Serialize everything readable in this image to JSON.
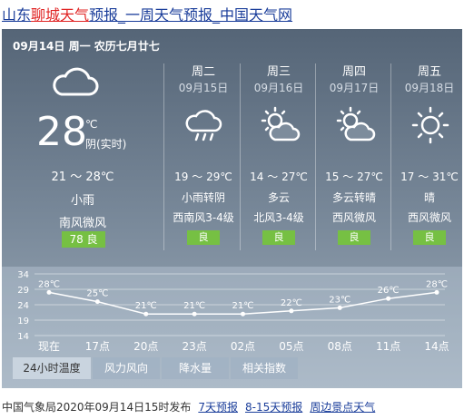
{
  "page_title": {
    "part1": "山东",
    "part2": "聊城天气",
    "part3": "预报_一周天气预报_中国天气网"
  },
  "date_line": "09月14日 周一 农历七月廿七",
  "today": {
    "icon": "cloudy-icon",
    "temp": "28",
    "unit": "℃",
    "desc": "阴(实时)",
    "range": "21 ～ 28℃",
    "weather": "小雨",
    "wind": "南风微风",
    "aqi": "78  良"
  },
  "forecast": [
    {
      "day": "周二",
      "date": "09月15日",
      "icon": "cloud-rain-icon",
      "range": "19 ～ 29℃",
      "weather": "小雨转阴",
      "wind": "西南风3-4级",
      "aqi": "良"
    },
    {
      "day": "周三",
      "date": "09月16日",
      "icon": "partly-cloudy-icon",
      "range": "14 ～ 27℃",
      "weather": "多云",
      "wind": "北风3-4级",
      "aqi": "良"
    },
    {
      "day": "周四",
      "date": "09月17日",
      "icon": "partly-cloudy-icon",
      "range": "15 ～ 27℃",
      "weather": "多云转晴",
      "wind": "西风微风",
      "aqi": "良"
    },
    {
      "day": "周五",
      "date": "09月18日",
      "icon": "sun-icon",
      "range": "17 ～ 31℃",
      "weather": "晴",
      "wind": "西风微风",
      "aqi": "良"
    }
  ],
  "chart_data": {
    "type": "line",
    "categories": [
      "现在",
      "17点",
      "20点",
      "23点",
      "02点",
      "05点",
      "08点",
      "11点",
      "14点"
    ],
    "values": [
      28,
      25,
      21,
      21,
      21,
      22,
      23,
      26,
      28
    ],
    "labels": [
      "28℃",
      "25℃",
      "21℃",
      "21℃",
      "21℃",
      "22℃",
      "23℃",
      "26℃",
      "28℃"
    ],
    "y_ticks": [
      "34",
      "29",
      "24",
      "19",
      "14"
    ],
    "ylim": [
      14,
      34
    ],
    "grid": true,
    "color": "#ffffff"
  },
  "tabs": [
    "24小时温度",
    "风力风向",
    "降水量",
    "相关指数"
  ],
  "footer": {
    "text": "中国气象局2020年09月14日15时发布",
    "links": [
      "7天预报",
      "8-15天预报",
      "周边景点天气"
    ]
  }
}
